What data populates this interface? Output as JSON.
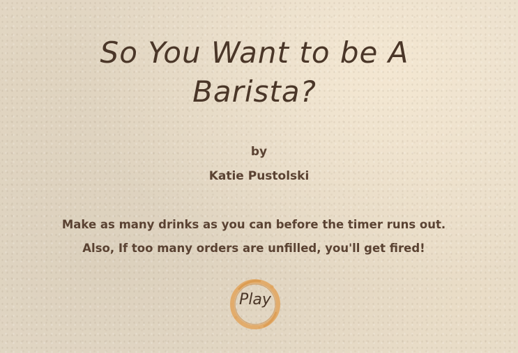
{
  "title": "So You Want to be A Barista?",
  "byline": {
    "by": "by",
    "author": "Katie Pustolski"
  },
  "instructions": {
    "line1": "Make as many drinks as you can before the timer runs out.",
    "line2": "Also, If too many orders are unfilled, you'll get fired!"
  },
  "play_button": {
    "label": "Play",
    "icon": "coffee-ring-stain-icon",
    "ring_color": "#e0a25a"
  },
  "colors": {
    "background": "#e6dccb",
    "text": "#4e3b2c"
  }
}
